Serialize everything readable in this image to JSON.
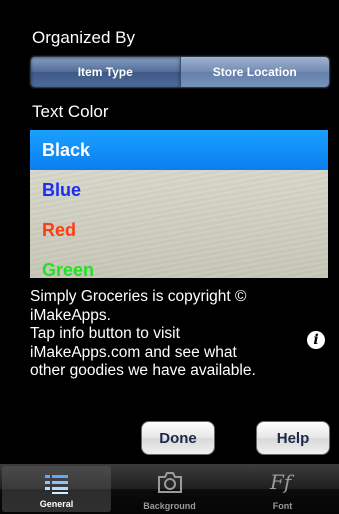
{
  "organized_by": {
    "title": "Organized By",
    "segments": [
      {
        "label": "Item Type",
        "selected": true
      },
      {
        "label": "Store Location",
        "selected": false
      }
    ]
  },
  "text_color": {
    "title": "Text Color",
    "options": [
      {
        "label": "Black",
        "color": "#ffffff",
        "selected": true
      },
      {
        "label": "Blue",
        "color": "#1a2cf0",
        "selected": false
      },
      {
        "label": "Red",
        "color": "#ff3b14",
        "selected": false
      },
      {
        "label": "Green",
        "color": "#22e022",
        "selected": false
      }
    ]
  },
  "copyright": {
    "lines": [
      "Simply Groceries is copyright ©",
      "iMakeApps.",
      "Tap info button to visit",
      "iMakeApps.com and see what",
      "other goodies we have available."
    ]
  },
  "info_icon": "i",
  "buttons": {
    "done": "Done",
    "help": "Help"
  },
  "tabbar": {
    "tabs": [
      {
        "label": "General",
        "icon": "list-icon",
        "selected": true
      },
      {
        "label": "Background",
        "icon": "camera-icon",
        "selected": false
      },
      {
        "label": "Font",
        "icon": "font-icon",
        "selected": false
      }
    ]
  }
}
